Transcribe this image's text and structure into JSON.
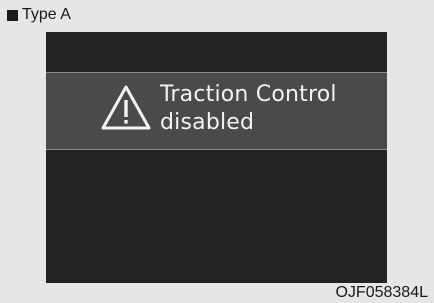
{
  "header": {
    "type_label": "Type A"
  },
  "display": {
    "message_line1": "Traction Control",
    "message_line2": "disabled",
    "icon": "warning-triangle-icon",
    "colors": {
      "screen_background": "#232323",
      "banner_background": "#4a4a4a",
      "text": "#f2f2f2"
    }
  },
  "footer": {
    "image_code": "OJF058384L"
  }
}
